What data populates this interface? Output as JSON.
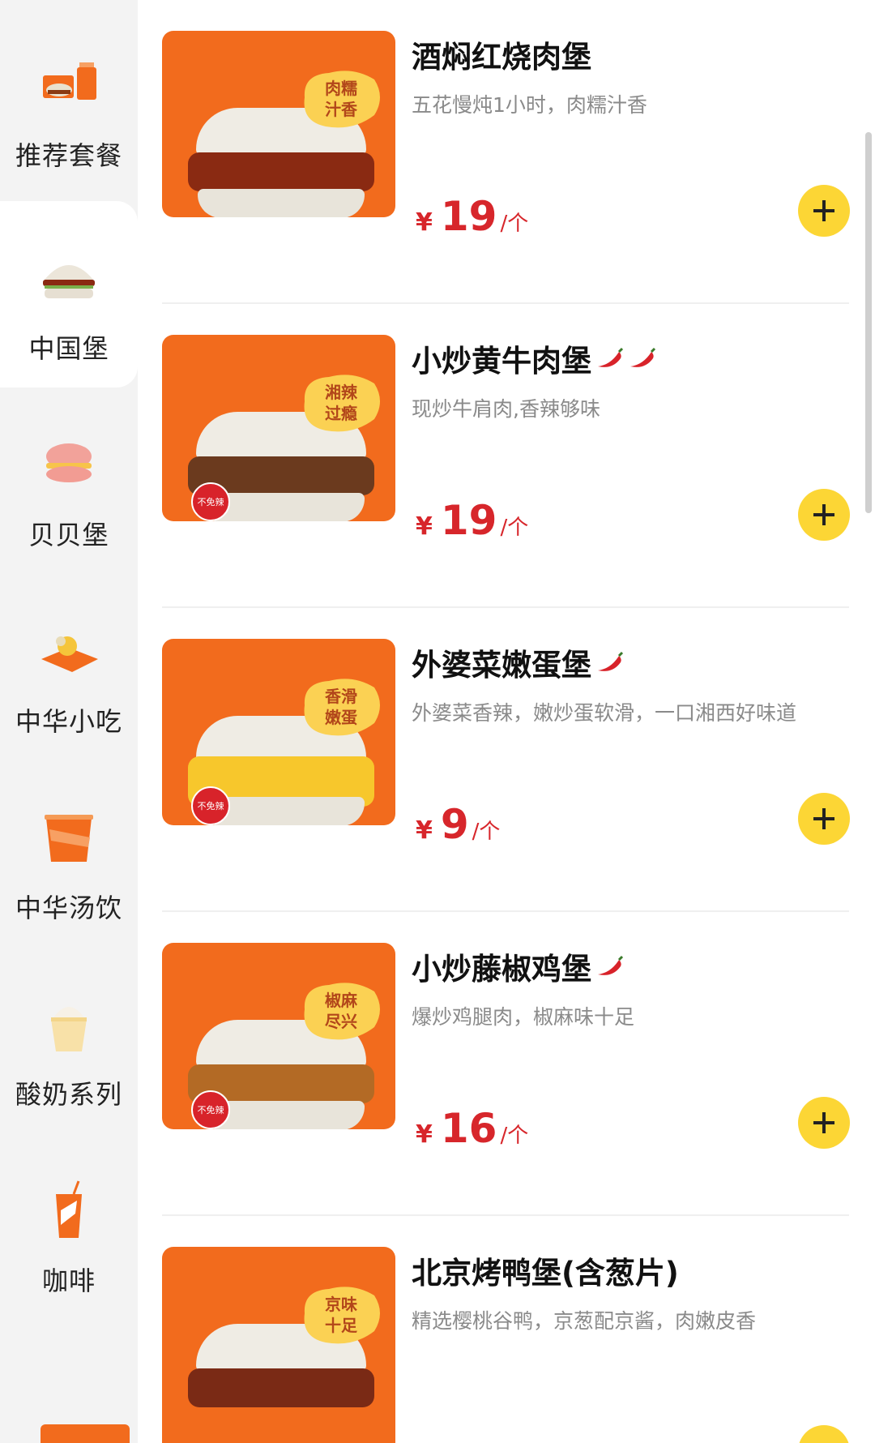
{
  "sidebar": {
    "items": [
      {
        "label": "推荐套餐",
        "icon": "combo-meal-icon",
        "active": false
      },
      {
        "label": "中国堡",
        "icon": "burger-icon",
        "active": true
      },
      {
        "label": "贝贝堡",
        "icon": "small-burger-icon",
        "active": false
      },
      {
        "label": "中华小吃",
        "icon": "snack-icon",
        "active": false
      },
      {
        "label": "中华汤饮",
        "icon": "soup-cup-icon",
        "active": false
      },
      {
        "label": "酸奶系列",
        "icon": "yogurt-icon",
        "active": false
      },
      {
        "label": "咖啡",
        "icon": "coffee-cup-icon",
        "active": false
      }
    ]
  },
  "products": [
    {
      "name": "酒焖红烧肉堡",
      "chili": 0,
      "desc": "五花慢炖1小时，肉糯汁香",
      "yen": "¥",
      "price": "19",
      "unit": "/个",
      "badge": [
        "肉糯",
        "汁香"
      ],
      "spicy_tag": "",
      "filling_color": "#8a2a12"
    },
    {
      "name": "小炒黄牛肉堡",
      "chili": 2,
      "desc": "现炒牛肩肉,香辣够味",
      "yen": "¥",
      "price": "19",
      "unit": "/个",
      "badge": [
        "湘辣",
        "过瘾"
      ],
      "spicy_tag": "不免辣",
      "filling_color": "#6b3a1e"
    },
    {
      "name": "外婆菜嫩蛋堡",
      "chili": 1,
      "desc": "外婆菜香辣，嫩炒蛋软滑，一口湘西好味道",
      "yen": "¥",
      "price": "9",
      "unit": "/个",
      "badge": [
        "香滑",
        "嫩蛋"
      ],
      "spicy_tag": "不免辣",
      "filling_color": "#f7c72c"
    },
    {
      "name": "小炒藤椒鸡堡",
      "chili": 1,
      "desc": "爆炒鸡腿肉，椒麻味十足",
      "yen": "¥",
      "price": "16",
      "unit": "/个",
      "badge": [
        "椒麻",
        "尽兴"
      ],
      "spicy_tag": "不免辣",
      "filling_color": "#b36a25"
    },
    {
      "name": "北京烤鸭堡(含葱片)",
      "chili": 0,
      "desc": "精选樱桃谷鸭，京葱配京酱，肉嫩皮香",
      "yen": "",
      "price": "",
      "unit": "",
      "badge": [
        "京味",
        "十足"
      ],
      "spicy_tag": "",
      "filling_color": "#7a2a15"
    }
  ],
  "colors": {
    "accent_orange": "#f26b1d",
    "price_red": "#d7262b",
    "add_yellow": "#fcd635"
  }
}
